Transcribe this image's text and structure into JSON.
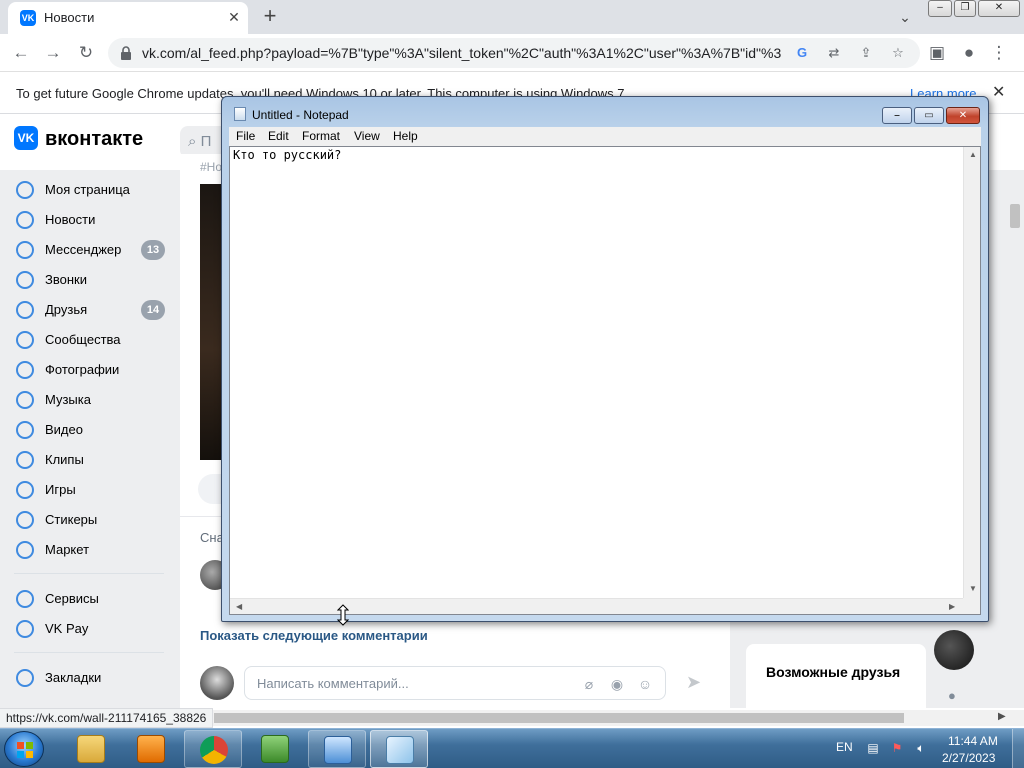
{
  "browser": {
    "tab": {
      "title": "Новости",
      "favicon": "VK"
    },
    "url": "vk.com/al_feed.php?payload=%7B\"type\"%3A\"silent_token\"%2C\"auth\"%3A1%2C\"user\"%3A%7B\"id\"%3...",
    "infobar": {
      "message": "To get future Google Chrome updates, you'll need Windows 10 or later. This computer is using Windows 7.",
      "learn_more": "Learn more"
    },
    "status_url": "https://vk.com/wall-211174165_38826"
  },
  "vk": {
    "brand": "вконтакте",
    "search_placeholder": "П",
    "sidebar": [
      {
        "label": "Моя страница",
        "icon": "user-circle-icon"
      },
      {
        "label": "Новости",
        "icon": "news-icon"
      },
      {
        "label": "Мессенджер",
        "icon": "chat-icon",
        "badge": "13"
      },
      {
        "label": "Звонки",
        "icon": "phone-icon"
      },
      {
        "label": "Друзья",
        "icon": "friends-icon",
        "badge": "14"
      },
      {
        "label": "Сообщества",
        "icon": "groups-icon"
      },
      {
        "label": "Фотографии",
        "icon": "photo-icon"
      },
      {
        "label": "Музыка",
        "icon": "music-icon"
      },
      {
        "label": "Видео",
        "icon": "video-icon"
      },
      {
        "label": "Клипы",
        "icon": "clips-icon"
      },
      {
        "label": "Игры",
        "icon": "gamepad-icon"
      },
      {
        "label": "Стикеры",
        "icon": "sticker-icon"
      },
      {
        "label": "Маркет",
        "icon": "market-icon"
      },
      {
        "label": "Сервисы",
        "icon": "services-icon"
      },
      {
        "label": "VK Pay",
        "icon": "vkpay-icon"
      },
      {
        "label": "Закладки",
        "icon": "bookmark-icon"
      }
    ],
    "feed": {
      "hashtag": "#Но",
      "comments_heading": "Сна",
      "show_more": "Показать следующие комментарии",
      "comment_placeholder": "Написать комментарий..."
    },
    "right": {
      "friends_title": "Возможные друзья"
    }
  },
  "notepad": {
    "title": "Untitled - Notepad",
    "menu": [
      "File",
      "Edit",
      "Format",
      "View",
      "Help"
    ],
    "content": "Кто то русский?"
  },
  "taskbar": {
    "language": "EN",
    "time": "11:44 AM",
    "date": "2/27/2023",
    "apps": [
      "explorer-icon",
      "media-player-icon",
      "chrome-icon",
      "csharp-icon",
      "control-panel-icon",
      "notepad-icon"
    ]
  }
}
